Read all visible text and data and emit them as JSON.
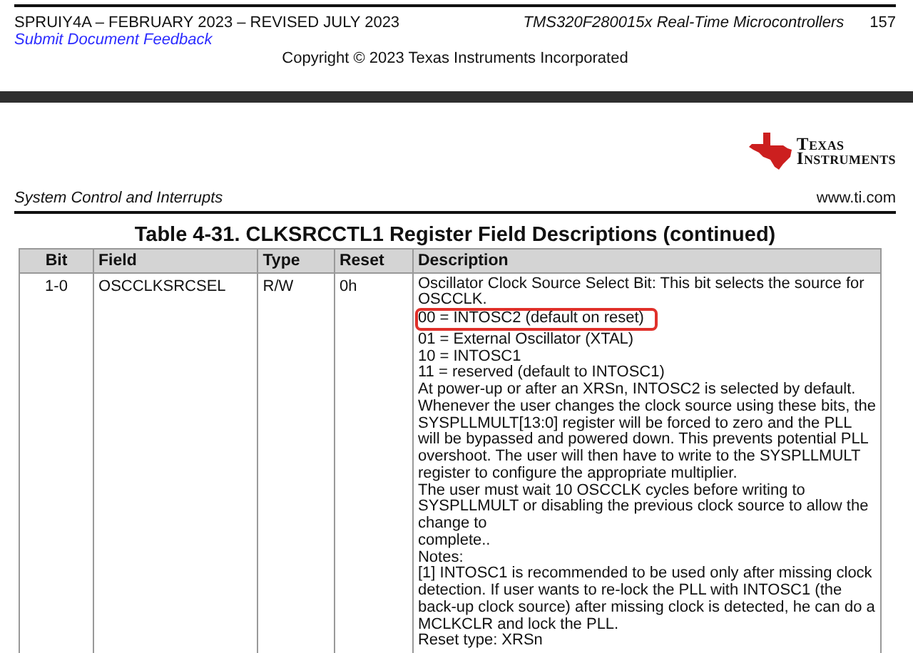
{
  "header": {
    "doc_id": "SPRUIY4A – FEBRUARY 2023 – REVISED JULY 2023",
    "feedback_link": "Submit Document Feedback",
    "product": "TMS320F280015x Real-Time Microcontrollers",
    "page_number": "157",
    "copyright": "Copyright © 2023 Texas Instruments Incorporated"
  },
  "logo": {
    "line_1": "Texas",
    "line_2": "Instruments"
  },
  "section": {
    "title": "System Control and Interrupts",
    "site": "www.ti.com"
  },
  "table": {
    "title": "Table 4-31. CLKSRCCTL1 Register Field Descriptions (continued)",
    "columns": [
      "Bit",
      "Field",
      "Type",
      "Reset",
      "Description"
    ],
    "rows": [
      {
        "bit": "1-0",
        "field": "OSCCLKSRCSEL",
        "type": "R/W",
        "reset": "0h",
        "description": [
          {
            "text": "Oscillator Clock Source Select Bit: This bit selects the source for",
            "highlighted": false
          },
          {
            "text": "OSCCLK.",
            "highlighted": false
          },
          {
            "text": "00 = INTOSC2 (default on reset)",
            "highlighted": true
          },
          {
            "text": "01 = External Oscillator (XTAL)",
            "highlighted": false
          },
          {
            "text": "10 = INTOSC1",
            "highlighted": false
          },
          {
            "text": "11 = reserved (default to INTOSC1)",
            "highlighted": false
          },
          {
            "text": "At power-up or after an XRSn, INTOSC2 is selected by default.",
            "highlighted": false
          },
          {
            "text": "Whenever the user changes the clock source using these bits, the",
            "highlighted": false
          },
          {
            "text": "SYSPLLMULT[13:0] register will be forced to zero and the PLL",
            "highlighted": false
          },
          {
            "text": "will be bypassed and powered down. This prevents potential PLL",
            "highlighted": false
          },
          {
            "text": "overshoot. The user will then have to write to the SYSPLLMULT",
            "highlighted": false
          },
          {
            "text": "register to configure the appropriate multiplier.",
            "highlighted": false
          },
          {
            "text": "The user must wait 10 OSCCLK cycles before writing to",
            "highlighted": false
          },
          {
            "text": "SYSPLLMULT or disabling the previous clock source to allow the",
            "highlighted": false
          },
          {
            "text": "change to",
            "highlighted": false
          },
          {
            "text": "complete..",
            "highlighted": false
          },
          {
            "text": "Notes:",
            "highlighted": false
          },
          {
            "text": "[1] INTOSC1 is recommended to be used only after missing clock",
            "highlighted": false
          },
          {
            "text": "detection. If user wants to re-lock the PLL with INTOSC1 (the",
            "highlighted": false
          },
          {
            "text": "back-up clock source) after missing clock is detected, he can do a",
            "highlighted": false
          },
          {
            "text": "MCLKCLR and lock the PLL.",
            "highlighted": false
          },
          {
            "text": "Reset type: XRSn",
            "highlighted": false
          }
        ]
      }
    ]
  }
}
